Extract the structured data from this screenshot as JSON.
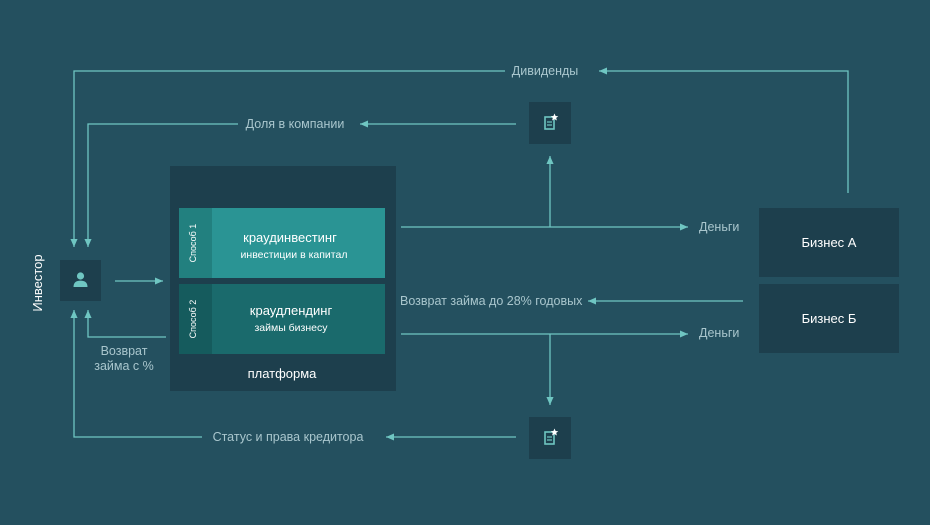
{
  "colors": {
    "background": "#24505f",
    "box_dark": "#1d3f4d",
    "method_1": "#2a9494",
    "method_1_tab": "#22807f",
    "method_2": "#1a6a6c",
    "method_2_tab": "#155b5d",
    "line": "#6fc6c2",
    "label": "#a9c6cd"
  },
  "investor": {
    "label": "Инвестор",
    "icon": "user-icon"
  },
  "platform": {
    "label": "платформа",
    "method_1": {
      "tab": "Способ 1",
      "title": "краудинвестинг",
      "subtitle": "инвестиции в капитал"
    },
    "method_2": {
      "tab": "Способ 2",
      "title": "краудлендинг",
      "subtitle": "займы бизнесу"
    }
  },
  "business_a": {
    "label": "Бизнес А"
  },
  "business_b": {
    "label": "Бизнес Б"
  },
  "flows": {
    "dividends": "Дивиденды",
    "company_share": "Доля в компании",
    "money_a": "Деньги",
    "loan_return_business": "Возврат займа до 28% годовых",
    "money_b": "Деньги",
    "loan_return_investor_1": "Возврат",
    "loan_return_investor_2": "займа с %",
    "creditor_status": "Статус и права кредитора"
  },
  "documents": {
    "top_icon": "document-star-icon",
    "bottom_icon": "document-star-icon"
  }
}
